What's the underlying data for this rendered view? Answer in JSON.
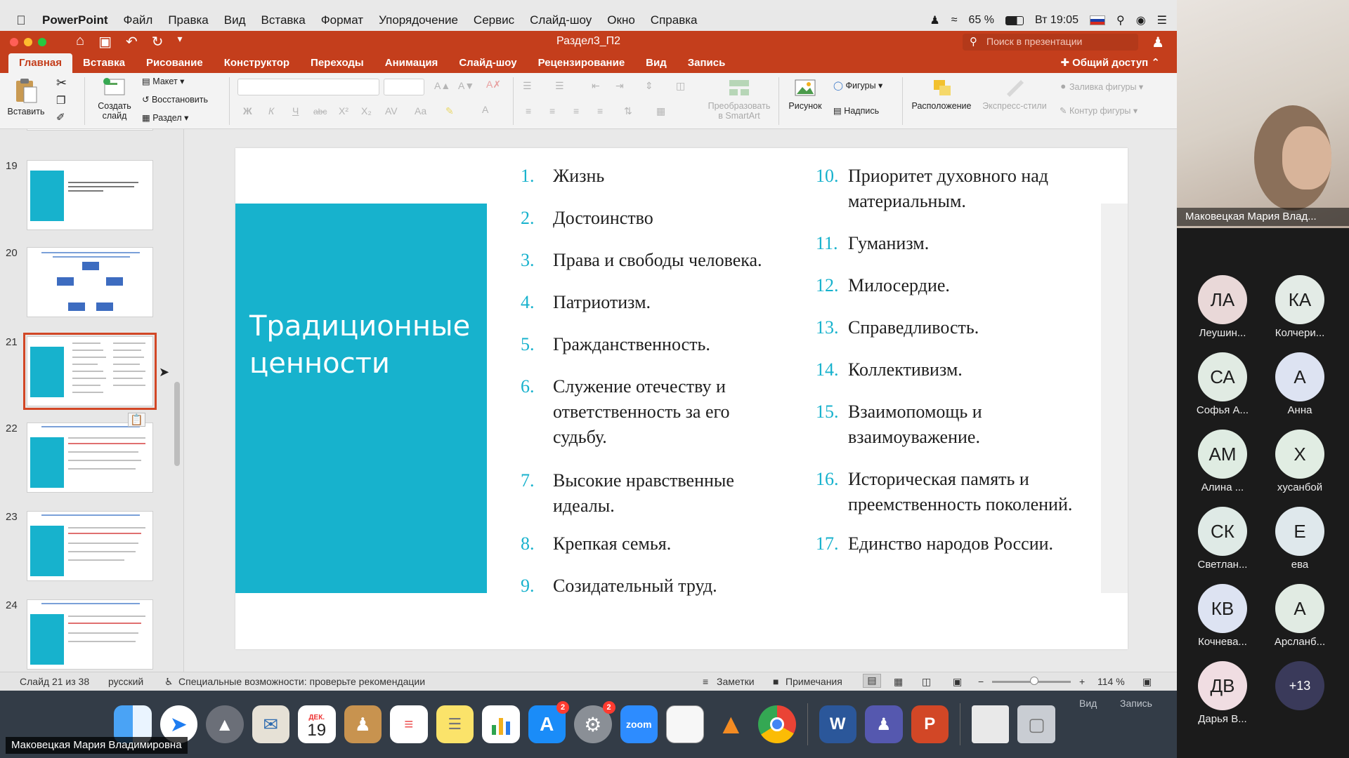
{
  "menubar": {
    "app_name": "PowerPoint",
    "items": [
      "Файл",
      "Правка",
      "Вид",
      "Вставка",
      "Формат",
      "Упорядочение",
      "Сервис",
      "Слайд-шоу",
      "Окно",
      "Справка"
    ],
    "battery": "65 %",
    "clock": "Вт 19:05"
  },
  "titlebar": {
    "doc_title": "Раздел3_П2",
    "search_placeholder": "Поиск в презентации"
  },
  "ribbon_tabs": [
    "Главная",
    "Вставка",
    "Рисование",
    "Конструктор",
    "Переходы",
    "Анимация",
    "Слайд-шоу",
    "Рецензирование",
    "Вид",
    "Запись"
  ],
  "share_label": "Общий доступ",
  "ribbon": {
    "paste": "Вставить",
    "new_slide_1": "Создать",
    "new_slide_2": "слайд",
    "layout": "Макет",
    "reset": "Восстановить",
    "section": "Раздел",
    "smartart_1": "Преобразовать",
    "smartart_2": "в SmartArt",
    "picture": "Рисунок",
    "shapes": "Фигуры",
    "textbox": "Надпись",
    "arrange": "Расположение",
    "quick_styles": "Экспресс-стили",
    "shape_fill": "Заливка фигуры",
    "shape_outline": "Контур фигуры"
  },
  "thumbnails": {
    "numbers": [
      "19",
      "20",
      "21",
      "22",
      "23",
      "24"
    ],
    "selected": "21"
  },
  "slide": {
    "title": "Традиционные ценности",
    "items_left": [
      {
        "num": "1.",
        "text": "Жизнь"
      },
      {
        "num": "2.",
        "text": "Достоинство"
      },
      {
        "num": "3.",
        "text": "Права и свободы человека."
      },
      {
        "num": "4.",
        "text": "Патриотизм."
      },
      {
        "num": "5.",
        "text": "Гражданственность."
      },
      {
        "num": "6.",
        "text": "Служение отечеству и ответственность за его судьбу."
      },
      {
        "num": "7.",
        "text": "Высокие нравственные идеалы."
      },
      {
        "num": "8.",
        "text": "Крепкая семья."
      },
      {
        "num": "9.",
        "text": "Созидательный труд."
      }
    ],
    "items_right": [
      {
        "num": "10.",
        "text": "Приоритет духовного над материальным."
      },
      {
        "num": "11.",
        "text": "Гуманизм."
      },
      {
        "num": "12.",
        "text": "Милосердие."
      },
      {
        "num": "13.",
        "text": "Справедливость."
      },
      {
        "num": "14.",
        "text": "Коллективизм."
      },
      {
        "num": "15.",
        "text": "Взаимопомощь и взаимоуважение."
      },
      {
        "num": "16.",
        "text": "Историческая память и преемственность поколений."
      },
      {
        "num": "17.",
        "text": "Единство народов России."
      }
    ],
    "accent_color": "#17b2cd"
  },
  "statusbar": {
    "slide_counter": "Слайд 21 из 38",
    "language": "русский",
    "accessibility": "Специальные возможности: проверьте рекомендации",
    "notes": "Заметки",
    "comments": "Примечания",
    "zoom": "114 %"
  },
  "dock": {
    "calendar_month": "ДЕК.",
    "calendar_day": "19",
    "appstore_badge": "2",
    "settings_badge": "2",
    "zoom_label": "zoom",
    "word_label": "W",
    "ppt_label": "P",
    "right_tabs": [
      "Вид",
      "Запись"
    ]
  },
  "presenter_name": "Маковецкая Мария Владимировна",
  "zoom_panel": {
    "speaker_name": "Маковецкая Мария Влад...",
    "participants": [
      {
        "initials": "ЛА",
        "name": "Леушин...",
        "color": "#e9d8d8"
      },
      {
        "initials": "КА",
        "name": "Колчери...",
        "color": "#e3ebe6"
      },
      {
        "initials": "СА",
        "name": "Софья А...",
        "color": "#e1ebe3"
      },
      {
        "initials": "А",
        "name": "Анна",
        "color": "#dde3f2"
      },
      {
        "initials": "АМ",
        "name": "Алина ...",
        "color": "#dfece2"
      },
      {
        "initials": "Х",
        "name": "хусанбой",
        "color": "#e1ede3"
      },
      {
        "initials": "СК",
        "name": "Светлан...",
        "color": "#dfeae6"
      },
      {
        "initials": "Е",
        "name": "ева",
        "color": "#dfe8ec"
      },
      {
        "initials": "КВ",
        "name": "Кочнева...",
        "color": "#dde3f2"
      },
      {
        "initials": "А",
        "name": "Арсланб...",
        "color": "#e1ebe3"
      },
      {
        "initials": "ДВ",
        "name": "Дарья В...",
        "color": "#f0dde2"
      },
      {
        "initials": "+13",
        "name": "",
        "color": "#3a3a5a"
      }
    ]
  }
}
